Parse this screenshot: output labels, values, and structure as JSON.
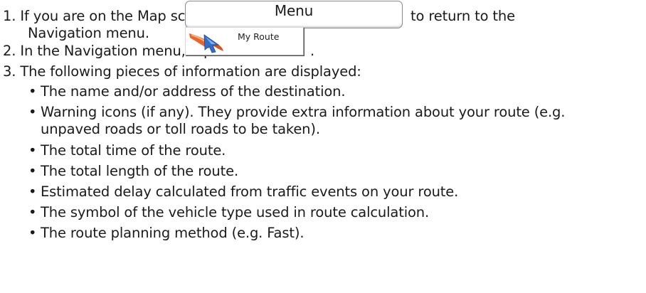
{
  "steps": [
    {
      "number": "1.",
      "before": "If you are on the Map screen, tap",
      "button_label": "Menu",
      "after": "to return to the",
      "continuation": "Navigation menu."
    },
    {
      "number": "2.",
      "before": "In the Navigation menu, tap",
      "button_label": "My Route",
      "after": "."
    },
    {
      "number": "3.",
      "text": "The following pieces of information are displayed:"
    }
  ],
  "info_items": [
    {
      "lines": [
        "The name and/or address of the destination."
      ]
    },
    {
      "lines": [
        "Warning icons (if any). They provide extra information about your route (e.g.",
        "unpaved roads or toll roads to be taken)."
      ]
    },
    {
      "lines": [
        "The total time of the route."
      ]
    },
    {
      "lines": [
        "The total length of the route."
      ]
    },
    {
      "lines": [
        "Estimated delay calculated from traffic events on your route."
      ]
    },
    {
      "lines": [
        "The symbol of the vehicle type used in route calculation."
      ]
    },
    {
      "lines": [
        "The route planning method (e.g. Fast)."
      ]
    }
  ],
  "bullet_glyph": "•",
  "icons": {
    "route_button_icon": "route-arrow-icon"
  },
  "colors": {
    "text": "#1a1a1a",
    "route_icon_orange": "#e8662a",
    "route_icon_blue": "#2f6fc9"
  }
}
